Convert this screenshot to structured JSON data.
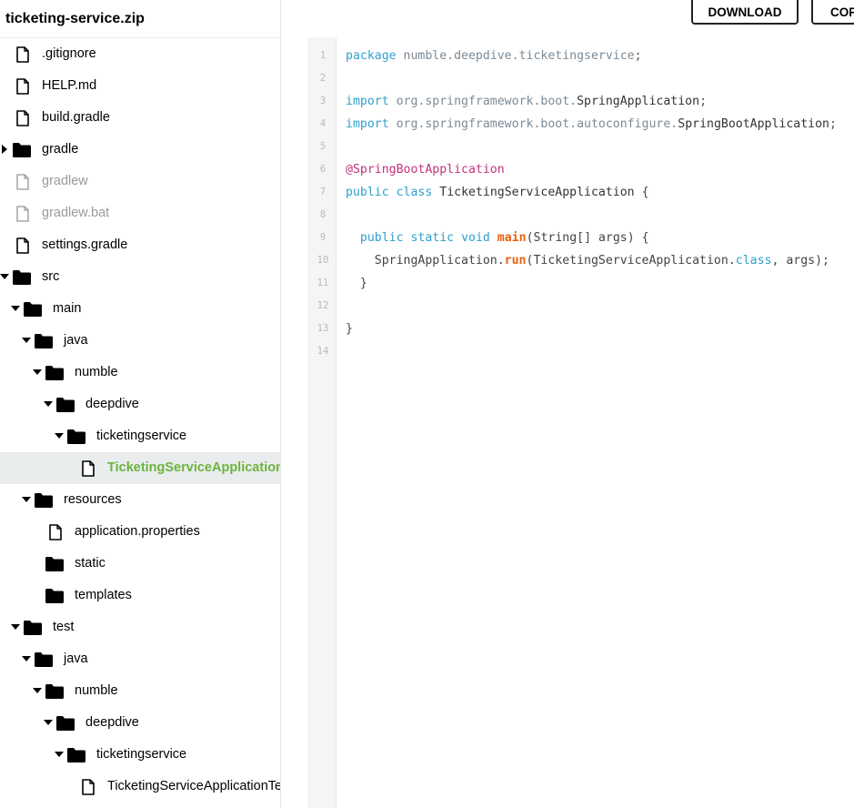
{
  "window": {
    "title": "ticketing-service.zip"
  },
  "actions": {
    "download_label": "DOWNLOAD",
    "copy_label": "COPY"
  },
  "tree": [
    {
      "label": ".gitignore",
      "type": "file",
      "depth": 0
    },
    {
      "label": "HELP.md",
      "type": "file",
      "depth": 0
    },
    {
      "label": "build.gradle",
      "type": "file",
      "depth": 0
    },
    {
      "label": "gradle",
      "type": "folder",
      "depth": 0,
      "expanded": false
    },
    {
      "label": "gradlew",
      "type": "file",
      "depth": 0,
      "disabled": true
    },
    {
      "label": "gradlew.bat",
      "type": "file",
      "depth": 0,
      "disabled": true
    },
    {
      "label": "settings.gradle",
      "type": "file",
      "depth": 0
    },
    {
      "label": "src",
      "type": "folder",
      "depth": 0,
      "expanded": true
    },
    {
      "label": "main",
      "type": "folder",
      "depth": 1,
      "expanded": true
    },
    {
      "label": "java",
      "type": "folder",
      "depth": 2,
      "expanded": true
    },
    {
      "label": "numble",
      "type": "folder",
      "depth": 3,
      "expanded": true
    },
    {
      "label": "deepdive",
      "type": "folder",
      "depth": 4,
      "expanded": true
    },
    {
      "label": "ticketingservice",
      "type": "folder",
      "depth": 5,
      "expanded": true
    },
    {
      "label": "TicketingServiceApplication.java",
      "type": "file",
      "depth": 6,
      "selected": true
    },
    {
      "label": "resources",
      "type": "folder",
      "depth": 2,
      "expanded": true
    },
    {
      "label": "application.properties",
      "type": "file",
      "depth": 3
    },
    {
      "label": "static",
      "type": "folder",
      "depth": 3,
      "leaf": true
    },
    {
      "label": "templates",
      "type": "folder",
      "depth": 3,
      "leaf": true
    },
    {
      "label": "test",
      "type": "folder",
      "depth": 1,
      "expanded": true
    },
    {
      "label": "java",
      "type": "folder",
      "depth": 2,
      "expanded": true
    },
    {
      "label": "numble",
      "type": "folder",
      "depth": 3,
      "expanded": true
    },
    {
      "label": "deepdive",
      "type": "folder",
      "depth": 4,
      "expanded": true
    },
    {
      "label": "ticketingservice",
      "type": "folder",
      "depth": 5,
      "expanded": true
    },
    {
      "label": "TicketingServiceApplicationTests.java",
      "type": "file",
      "depth": 6
    }
  ],
  "code": {
    "lines": [
      [
        [
          "kw",
          "package"
        ],
        [
          "txt",
          " "
        ],
        [
          "pkg",
          "numble.deepdive.ticketingservice"
        ],
        [
          "pun",
          ";"
        ]
      ],
      [],
      [
        [
          "kw",
          "import"
        ],
        [
          "txt",
          " "
        ],
        [
          "pkg",
          "org.springframework.boot."
        ],
        [
          "cls",
          "SpringApplication"
        ],
        [
          "pun",
          ";"
        ]
      ],
      [
        [
          "kw",
          "import"
        ],
        [
          "txt",
          " "
        ],
        [
          "pkg",
          "org.springframework.boot.autoconfigure."
        ],
        [
          "cls",
          "SpringBootApplication"
        ],
        [
          "pun",
          ";"
        ]
      ],
      [],
      [
        [
          "ann",
          "@SpringBootApplication"
        ]
      ],
      [
        [
          "kw",
          "public"
        ],
        [
          "txt",
          " "
        ],
        [
          "kw",
          "class"
        ],
        [
          "txt",
          " "
        ],
        [
          "cls",
          "TicketingServiceApplication"
        ],
        [
          "txt",
          " {"
        ]
      ],
      [],
      [
        [
          "txt",
          "  "
        ],
        [
          "kw",
          "public"
        ],
        [
          "txt",
          " "
        ],
        [
          "kw",
          "static"
        ],
        [
          "txt",
          " "
        ],
        [
          "kw",
          "void"
        ],
        [
          "txt",
          " "
        ],
        [
          "fn",
          "main"
        ],
        [
          "txt",
          "(String[] args) {"
        ]
      ],
      [
        [
          "txt",
          "    SpringApplication."
        ],
        [
          "fn",
          "run"
        ],
        [
          "txt",
          "(TicketingServiceApplication."
        ],
        [
          "kw",
          "class"
        ],
        [
          "txt",
          ", args);"
        ]
      ],
      [
        [
          "txt",
          "  }"
        ]
      ],
      [],
      [
        [
          "txt",
          "}"
        ]
      ],
      []
    ]
  }
}
